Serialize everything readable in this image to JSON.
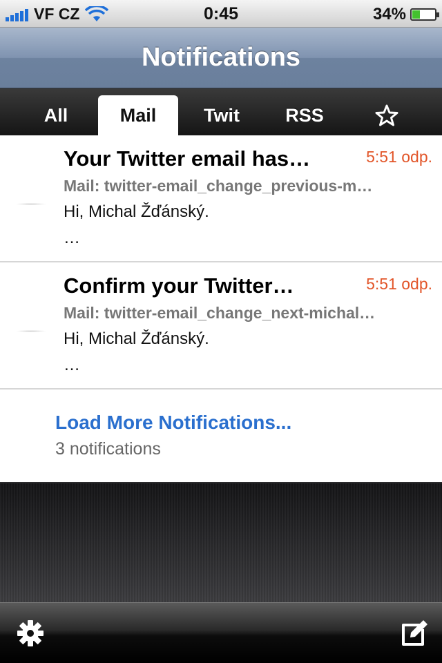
{
  "status_bar": {
    "carrier": "VF CZ",
    "time": "0:45",
    "battery": "34%",
    "battery_level": 0.34,
    "signal_bars": 5,
    "accent_color": "#1e6fd9"
  },
  "nav": {
    "title": "Notifications"
  },
  "tabs": [
    {
      "label": "All",
      "active": false
    },
    {
      "label": "Mail",
      "active": true
    },
    {
      "label": "Twit",
      "active": false
    },
    {
      "label": "RSS",
      "active": false
    },
    {
      "label": "",
      "icon": "star-icon",
      "active": false
    }
  ],
  "notifications": [
    {
      "title": "Your Twitter email has…",
      "time": "5:51 odp.",
      "sender": "Mail: twitter-email_change_previous-m…",
      "preview_line1": "Hi, Michal Žďánský.",
      "preview_line2": "…"
    },
    {
      "title": "Confirm your Twitter…",
      "time": "5:51 odp.",
      "sender": "Mail: twitter-email_change_next-michal…",
      "preview_line1": "Hi, Michal Žďánský.",
      "preview_line2": "…"
    }
  ],
  "load_more": {
    "title": "Load More Notifications...",
    "subtitle": "3 notifications"
  },
  "toolbar": {
    "left_icon": "gear-icon",
    "right_icon": "compose-icon"
  },
  "colors": {
    "time_color": "#e2562a",
    "link_color": "#2a6fce"
  }
}
